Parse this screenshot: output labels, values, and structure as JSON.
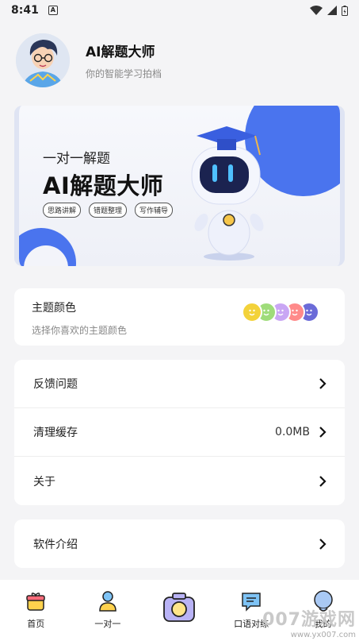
{
  "status": {
    "time": "8:41",
    "badge": "A"
  },
  "header": {
    "app_name": "AI解题大师",
    "subtitle": "你的智能学习拍档"
  },
  "banner": {
    "subtitle": "一对一解题",
    "title": "AI解题大师",
    "tags": [
      "思路讲解",
      "错题整理",
      "写作辅导"
    ]
  },
  "theme": {
    "title": "主题颜色",
    "desc": "选择你喜欢的主题颜色",
    "colors": [
      "#f3d23a",
      "#9fdc7a",
      "#c9a6f4",
      "#ff8a8a",
      "#6b6bd8"
    ]
  },
  "settings": {
    "feedback": "反馈问题",
    "clear_cache": "清理缓存",
    "cache_size": "0.0MB",
    "about": "关于",
    "intro": "软件介绍"
  },
  "nav": {
    "home": "首页",
    "one_on_one": "一对一",
    "oral": "口语对练",
    "mine": "我的"
  },
  "watermark": {
    "big": "007游戏网",
    "small": "www.yx007.com"
  }
}
